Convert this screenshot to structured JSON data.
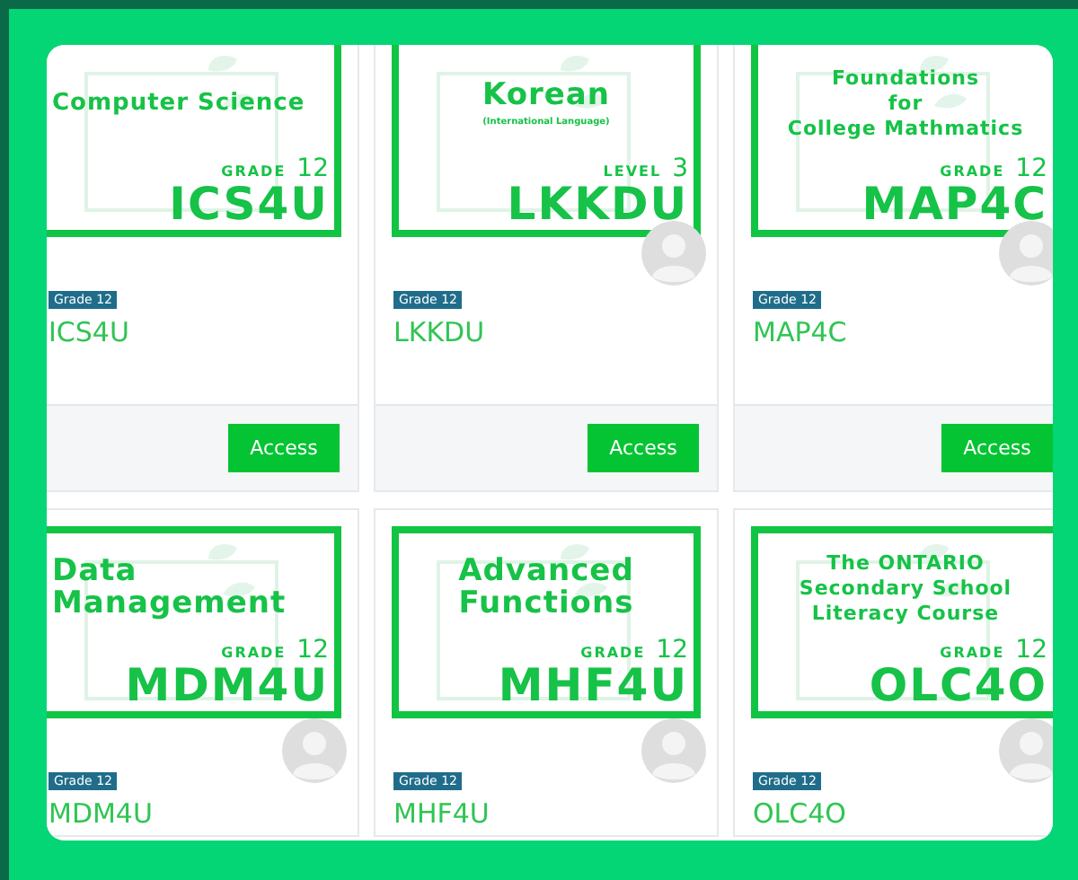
{
  "courses": [
    {
      "banner": {
        "title_lines": [
          "Computer Science"
        ],
        "level_label": "GRADE",
        "level_number": "12",
        "code": "ICS4U"
      },
      "badge": "Grade 12",
      "name": "ICS4U",
      "avatar": false,
      "button": "Access"
    },
    {
      "banner": {
        "title_lines": [
          "Korean"
        ],
        "subtitle": "(International Language)",
        "level_label": "LEVEL",
        "level_number": "3",
        "code": "LKKDU"
      },
      "badge": "Grade 12",
      "name": "LKKDU",
      "avatar": true,
      "button": "Access"
    },
    {
      "banner": {
        "title_lines": [
          "Foundations",
          "for",
          "College Mathmatics"
        ],
        "level_label": "GRADE",
        "level_number": "12",
        "code": "MAP4C"
      },
      "badge": "Grade 12",
      "name": "MAP4C",
      "avatar": true,
      "button": "Access"
    },
    {
      "banner": {
        "title_lines": [
          "Data",
          "Management"
        ],
        "level_label": "GRADE",
        "level_number": "12",
        "code": "MDM4U"
      },
      "badge": "Grade 12",
      "name": "MDM4U",
      "avatar": true
    },
    {
      "banner": {
        "title_lines": [
          "Advanced",
          "Functions"
        ],
        "level_label": "GRADE",
        "level_number": "12",
        "code": "MHF4U"
      },
      "badge": "Grade 12",
      "name": "MHF4U",
      "avatar": true
    },
    {
      "banner": {
        "title_lines": [
          "The ONTARIO",
          "Secondary School",
          "Literacy Course"
        ],
        "level_label": "GRADE",
        "level_number": "12",
        "code": "OLC4O"
      },
      "badge": "Grade 12",
      "name": "OLC4O",
      "avatar": true
    }
  ]
}
